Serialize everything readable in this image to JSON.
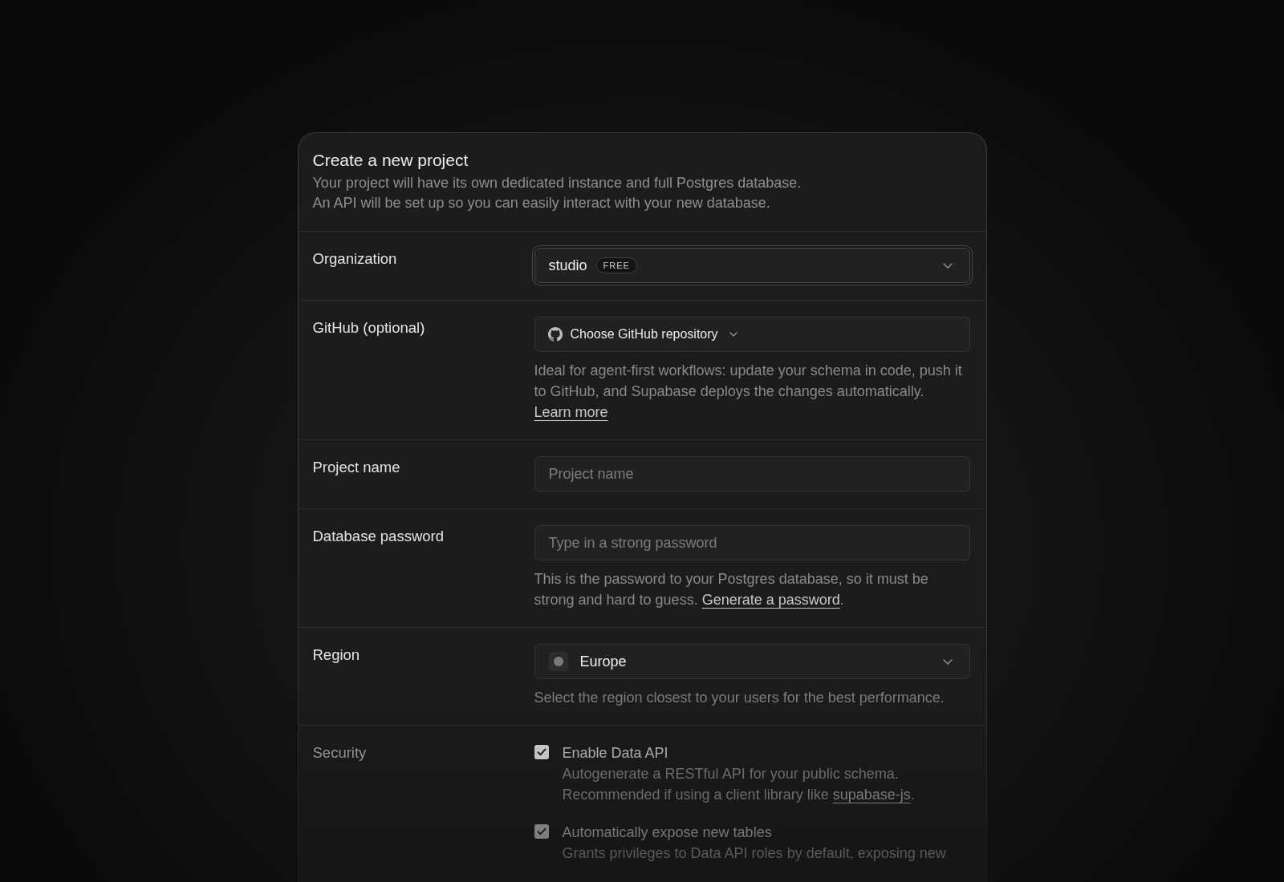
{
  "dialog": {
    "title": "Create a new project",
    "description": [
      "Your project will have its own dedicated instance and full Postgres database.",
      "An API will be set up so you can easily interact with your new database."
    ]
  },
  "fields": [
    {
      "kind": "select",
      "label": "Organization",
      "value": "studio",
      "badge": "FREE",
      "focused": true
    },
    {
      "kind": "repo-button",
      "label": "GitHub (optional)",
      "button": "Choose GitHub repository",
      "help": {
        "text": "Ideal for agent-first workflows: update your schema in code, push it to GitHub, and Supabase deploys the changes automatically.",
        "link": "Learn more"
      }
    },
    {
      "kind": "input",
      "label": "Project name",
      "placeholder": "Project name"
    },
    {
      "kind": "input",
      "label": "Database password",
      "placeholder": "Type in a strong password",
      "help": {
        "text": "This is the password to your Postgres database, so it must be strong and hard to guess.",
        "link": "Generate a password",
        "suffix": "."
      }
    },
    {
      "kind": "region-select",
      "label": "Region",
      "value": "Europe",
      "focused": false,
      "help": {
        "text": "Select the region closest to your users for the best performance."
      }
    },
    {
      "kind": "checkboxes",
      "label": "Security",
      "options": [
        {
          "label": "Enable Data API",
          "checked": true,
          "description": "Autogenerate a RESTful API for your public schema. Recommended if using a client library like",
          "link": "supabase-js",
          "suffix": "."
        },
        {
          "label": "Automatically expose new tables",
          "checked": true,
          "description": "Grants privileges to Data API roles by default, exposing new"
        }
      ]
    }
  ]
}
